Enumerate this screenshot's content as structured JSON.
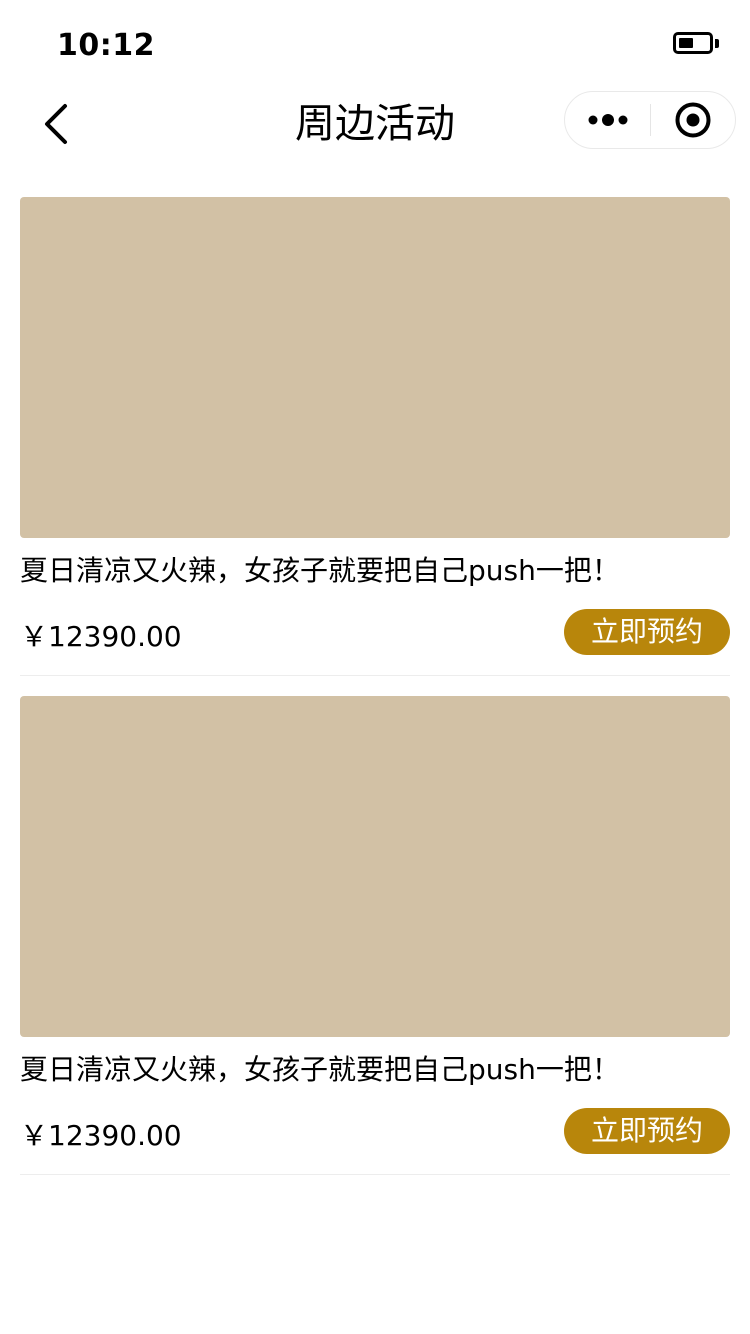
{
  "status_bar": {
    "time": "10:12",
    "battery_level": 0.5
  },
  "nav": {
    "title": "周边活动",
    "back_icon": "chevron-left-icon",
    "more_icon": "more-dots-icon",
    "close_icon": "target-circle-icon"
  },
  "colors": {
    "accent": "#B8860B",
    "image_placeholder": "#D2C1A5",
    "divider": "#EDEDED"
  },
  "activities": [
    {
      "title": "夏日清凉又火辣，女孩子就要把自己push一把！",
      "price": "￥12390.00",
      "button_label": "立即预约"
    },
    {
      "title": "夏日清凉又火辣，女孩子就要把自己push一把！",
      "price": "￥12390.00",
      "button_label": "立即预约"
    }
  ]
}
